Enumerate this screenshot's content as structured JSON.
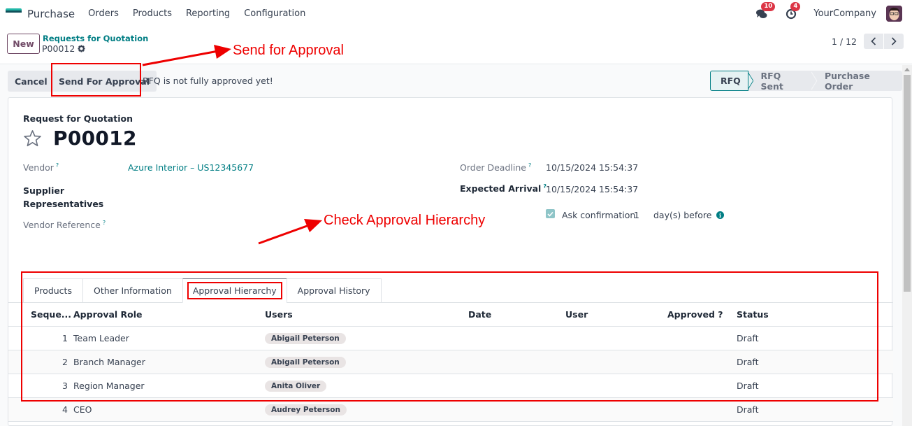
{
  "topnav": {
    "app_name": "Purchase",
    "menu": [
      "Orders",
      "Products",
      "Reporting",
      "Configuration"
    ],
    "messages_count": "10",
    "activities_count": "4",
    "company": "YourCompany"
  },
  "control_panel": {
    "new_label": "New",
    "breadcrumb_parent": "Requests for Quotation",
    "breadcrumb_current": "P00012",
    "pager": "1 / 12"
  },
  "statusbar": {
    "cancel_label": "Cancel",
    "send_label": "Send For Approval",
    "message": "RFQ is not fully approved yet!",
    "stages": [
      "RFQ",
      "RFQ Sent",
      "Purchase Order"
    ],
    "active_stage": "RFQ"
  },
  "form": {
    "doc_type": "Request for Quotation",
    "name": "P00012",
    "vendor_label": "Vendor",
    "vendor_value": "Azure Interior – US12345677",
    "supplier_reps_label_1": "Supplier",
    "supplier_reps_label_2": "Representatives",
    "vendor_ref_label": "Vendor Reference",
    "order_deadline_label": "Order Deadline",
    "order_deadline_value": "10/15/2024 15:54:37",
    "expected_arrival_label": "Expected Arrival",
    "expected_arrival_value": "10/15/2024 15:54:37",
    "ask_confirmation_label": "Ask confirmation",
    "ask_confirmation_days": "1",
    "ask_confirmation_suffix": "day(s) before",
    "ask_confirmation_checked": true,
    "help_mark": "?"
  },
  "tabs": [
    "Products",
    "Other Information",
    "Approval Hierarchy",
    "Approval History"
  ],
  "active_tab": "Approval Hierarchy",
  "table": {
    "columns": [
      "Seque...",
      "Approval Role",
      "Users",
      "Date",
      "User",
      "Approved ?",
      "Status"
    ],
    "rows": [
      {
        "seq": "1",
        "role": "Team Leader",
        "users": "Abigail Peterson",
        "date": "",
        "user": "",
        "approved": "",
        "status": "Draft"
      },
      {
        "seq": "2",
        "role": "Branch Manager",
        "users": "Abigail Peterson",
        "date": "",
        "user": "",
        "approved": "",
        "status": "Draft"
      },
      {
        "seq": "3",
        "role": "Region Manager",
        "users": "Anita Oliver",
        "date": "",
        "user": "",
        "approved": "",
        "status": "Draft"
      },
      {
        "seq": "4",
        "role": "CEO",
        "users": "Audrey Peterson",
        "date": "",
        "user": "",
        "approved": "",
        "status": "Draft"
      }
    ]
  },
  "annotations": {
    "send_for_approval": "Send for Approval",
    "check_hierarchy": "Check Approval Hierarchy",
    "color": "#e00000"
  }
}
